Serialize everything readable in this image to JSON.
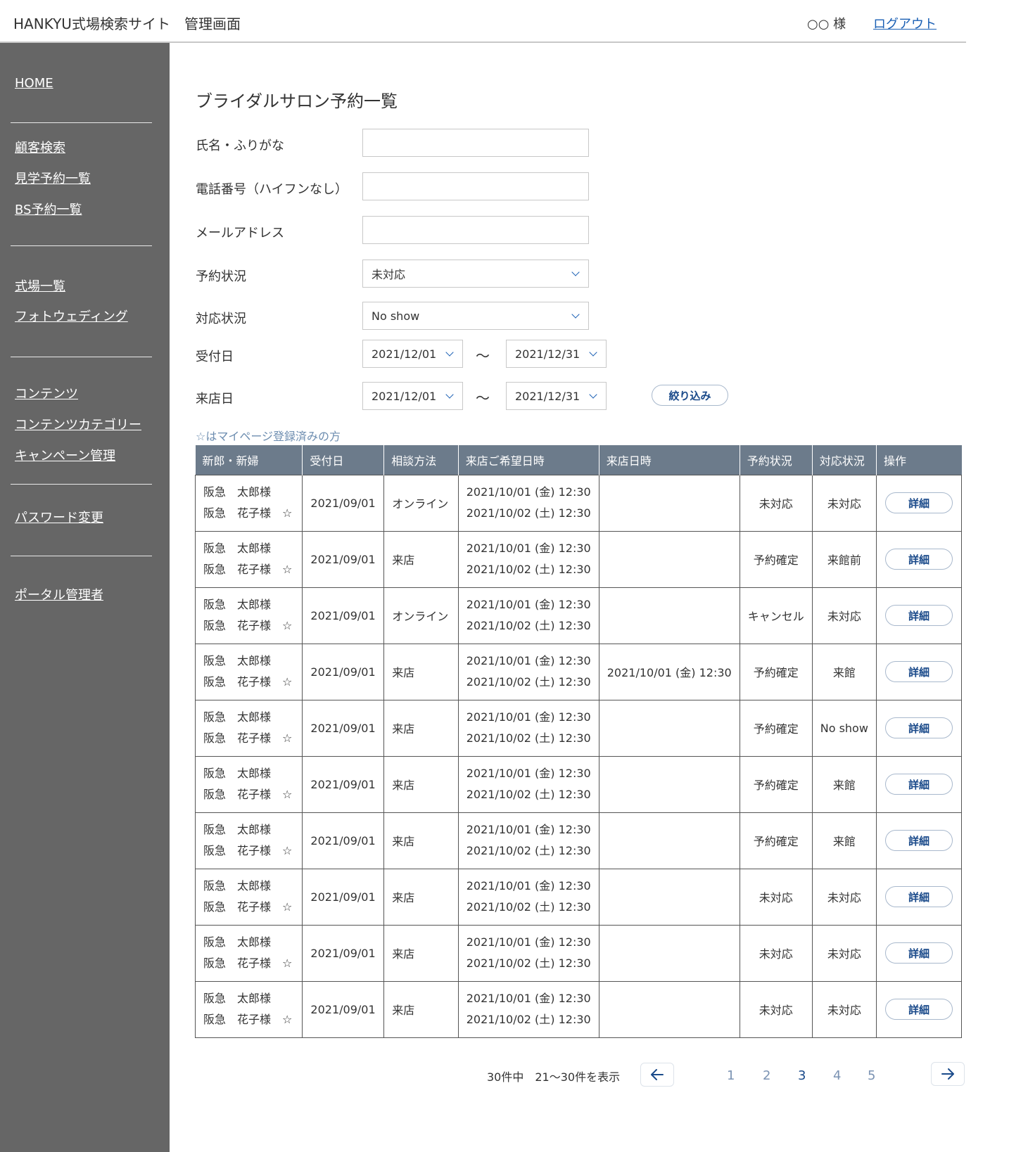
{
  "header": {
    "title": "HANKYU式場検索サイト　管理画面",
    "user": "○○ 様",
    "logout": "ログアウト"
  },
  "sidebar": {
    "home": "HOME",
    "customer_search": "顧客検索",
    "tour_reservations": "見学予約一覧",
    "bs_reservations": "BS予約一覧",
    "venues": "式場一覧",
    "photo_wedding": "フォトウェディング",
    "contents": "コンテンツ",
    "content_categories": "コンテンツカテゴリー",
    "campaigns": "キャンペーン管理",
    "password_change": "パスワード変更",
    "portal_admin": "ポータル管理者"
  },
  "page": {
    "title": "ブライダルサロン予約一覧"
  },
  "form": {
    "name_label": "氏名・ふりがな",
    "phone_label": "電話番号（ハイフンなし）",
    "email_label": "メールアドレス",
    "status_label": "予約状況",
    "status_value": "未対応",
    "response_label": "対応状況",
    "response_value": "No show",
    "received_label": "受付日",
    "received_from": "2021/12/01",
    "received_to": "2021/12/31",
    "visit_label": "来店日",
    "visit_from": "2021/12/01",
    "visit_to": "2021/12/31",
    "tilde": "〜",
    "filter_button": "絞り込み"
  },
  "note": "☆はマイページ登録済みの方",
  "table": {
    "headers": [
      "新郎・新婦",
      "受付日",
      "相談方法",
      "来店ご希望日時",
      "来店日時",
      "予約状況",
      "対応状況",
      "操作"
    ],
    "rows": [
      {
        "groom": "阪急　太郎様",
        "bride": "阪急　花子様　☆",
        "received": "2021/09/01",
        "method": "オンライン",
        "wish1": "2021/10/01 (金) 12:30",
        "wish2": "2021/10/02 (土) 12:30",
        "visit": "",
        "status": "未対応",
        "response": "未対応",
        "action": "詳細"
      },
      {
        "groom": "阪急　太郎様",
        "bride": "阪急　花子様　☆",
        "received": "2021/09/01",
        "method": "来店",
        "wish1": "2021/10/01 (金) 12:30",
        "wish2": "2021/10/02 (土) 12:30",
        "visit": "",
        "status": "予約確定",
        "response": "来館前",
        "action": "詳細"
      },
      {
        "groom": "阪急　太郎様",
        "bride": "阪急　花子様　☆",
        "received": "2021/09/01",
        "method": "オンライン",
        "wish1": "2021/10/01 (金) 12:30",
        "wish2": "2021/10/02 (土) 12:30",
        "visit": "",
        "status": "キャンセル",
        "response": "未対応",
        "action": "詳細"
      },
      {
        "groom": "阪急　太郎様",
        "bride": "阪急　花子様　☆",
        "received": "2021/09/01",
        "method": "来店",
        "wish1": "2021/10/01 (金) 12:30",
        "wish2": "2021/10/02 (土) 12:30",
        "visit": "2021/10/01 (金) 12:30",
        "status": "予約確定",
        "response": "来館",
        "action": "詳細"
      },
      {
        "groom": "阪急　太郎様",
        "bride": "阪急　花子様　☆",
        "received": "2021/09/01",
        "method": "来店",
        "wish1": "2021/10/01 (金) 12:30",
        "wish2": "2021/10/02 (土) 12:30",
        "visit": "",
        "status": "予約確定",
        "response": "No show",
        "action": "詳細"
      },
      {
        "groom": "阪急　太郎様",
        "bride": "阪急　花子様　☆",
        "received": "2021/09/01",
        "method": "来店",
        "wish1": "2021/10/01 (金) 12:30",
        "wish2": "2021/10/02 (土) 12:30",
        "visit": "",
        "status": "予約確定",
        "response": "来館",
        "action": "詳細"
      },
      {
        "groom": "阪急　太郎様",
        "bride": "阪急　花子様　☆",
        "received": "2021/09/01",
        "method": "来店",
        "wish1": "2021/10/01 (金) 12:30",
        "wish2": "2021/10/02 (土) 12:30",
        "visit": "",
        "status": "予約確定",
        "response": "来館",
        "action": "詳細"
      },
      {
        "groom": "阪急　太郎様",
        "bride": "阪急　花子様　☆",
        "received": "2021/09/01",
        "method": "来店",
        "wish1": "2021/10/01 (金) 12:30",
        "wish2": "2021/10/02 (土) 12:30",
        "visit": "",
        "status": "未対応",
        "response": "未対応",
        "action": "詳細"
      },
      {
        "groom": "阪急　太郎様",
        "bride": "阪急　花子様　☆",
        "received": "2021/09/01",
        "method": "来店",
        "wish1": "2021/10/01 (金) 12:30",
        "wish2": "2021/10/02 (土) 12:30",
        "visit": "",
        "status": "未対応",
        "response": "未対応",
        "action": "詳細"
      },
      {
        "groom": "阪急　太郎様",
        "bride": "阪急　花子様　☆",
        "received": "2021/09/01",
        "method": "来店",
        "wish1": "2021/10/01 (金) 12:30",
        "wish2": "2021/10/02 (土) 12:30",
        "visit": "",
        "status": "未対応",
        "response": "未対応",
        "action": "詳細"
      }
    ]
  },
  "pagination": {
    "summary": "30件中　21〜30件を表示",
    "pages": [
      "1",
      "2",
      "3",
      "4",
      "5"
    ],
    "current": "3",
    "prev_icon": "arrow-left-icon",
    "next_icon": "arrow-right-icon"
  },
  "colors": {
    "sidebar": "#666666",
    "table_header": "#6c7b8b",
    "link": "#1a5fb4",
    "button_text": "#1a4a8a"
  }
}
